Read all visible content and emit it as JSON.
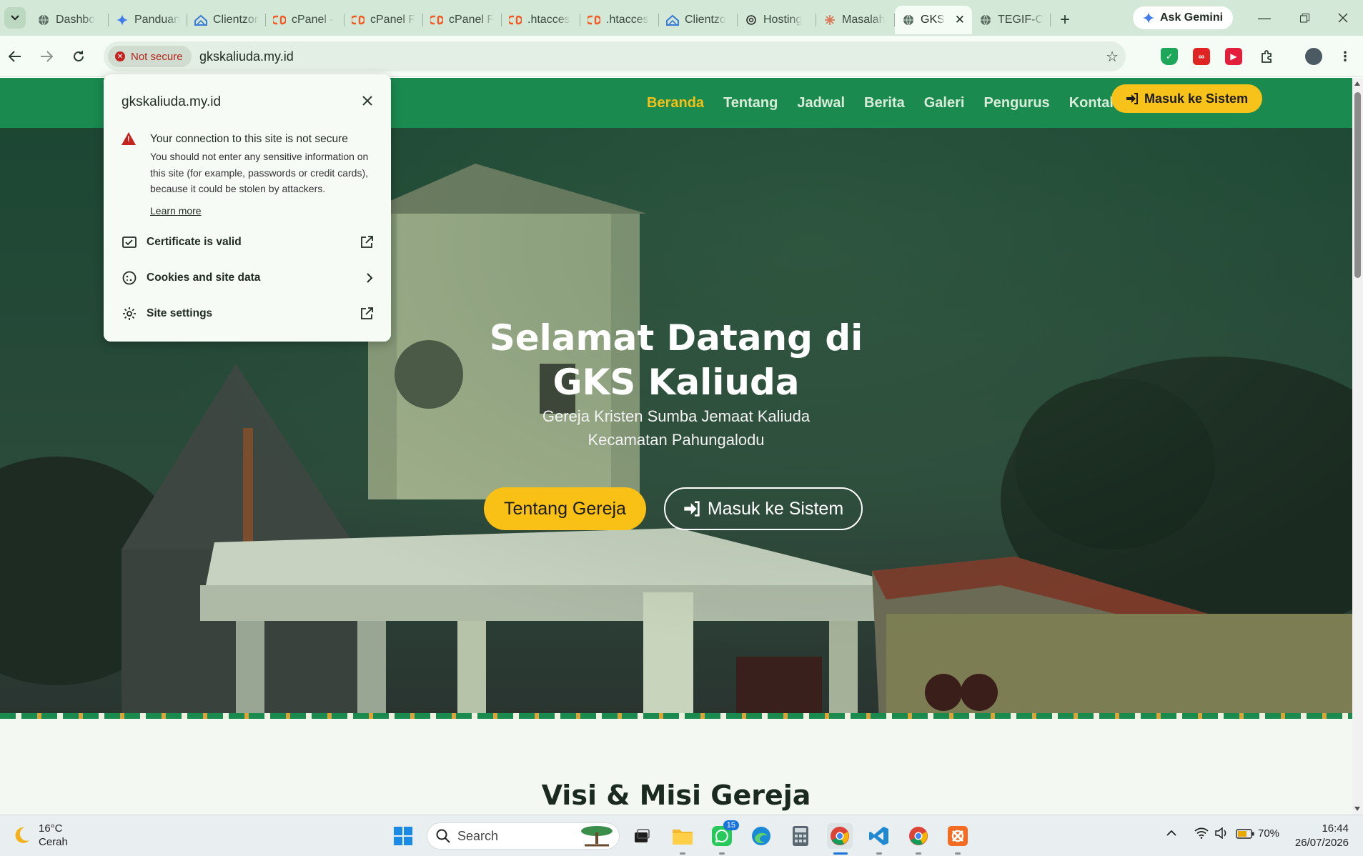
{
  "browser": {
    "tabs": [
      {
        "title": "Dashbo",
        "icon": "globe-icon"
      },
      {
        "title": "Panduan",
        "icon": "gemini-spark-icon"
      },
      {
        "title": "Clientzone",
        "icon": "clientzone-icon"
      },
      {
        "title": "cPanel -",
        "icon": "cpanel-icon"
      },
      {
        "title": "cPanel F",
        "icon": "cpanel-icon"
      },
      {
        "title": "cPanel F",
        "icon": "cpanel-icon"
      },
      {
        "title": ".htacces",
        "icon": "cpanel-icon"
      },
      {
        "title": ".htacces",
        "icon": "cpanel-icon"
      },
      {
        "title": "Clientzo",
        "icon": "clientzone-icon"
      },
      {
        "title": "Hosting",
        "icon": "openai-icon"
      },
      {
        "title": "Masalah",
        "icon": "claude-icon"
      },
      {
        "title": "GKS",
        "icon": "globe-icon",
        "active": true
      },
      {
        "title": "TEGIF-C",
        "icon": "globe-icon"
      }
    ],
    "gemini_label": "Ask Gemini",
    "security_chip": "Not secure",
    "url": "gkskaliuda.my.id"
  },
  "popup": {
    "host": "gkskaliuda.my.id",
    "warning_title": "Your connection to this site is not secure",
    "warning_body": "You should not enter any sensitive information on this site (for example, passwords or credit cards), because it could be stolen by attackers.",
    "learn_more": "Learn more",
    "rows": [
      {
        "label": "Certificate is valid",
        "icon": "certificate-icon",
        "action": "external-link-icon"
      },
      {
        "label": "Cookies and site data",
        "icon": "cookie-icon",
        "action": "chevron-right-icon"
      },
      {
        "label": "Site settings",
        "icon": "gear-icon",
        "action": "external-link-icon"
      }
    ]
  },
  "site": {
    "nav": [
      "Beranda",
      "Tentang",
      "Jadwal",
      "Berita",
      "Galeri",
      "Pengurus",
      "Kontak"
    ],
    "nav_active": "Beranda",
    "nav_cta": "Masuk ke Sistem",
    "hero_title_line1": "Selamat Datang di",
    "hero_title_line2": "GKS Kaliuda",
    "hero_sub_line1": "Gereja Kristen Sumba Jemaat Kaliuda",
    "hero_sub_line2": "Kecamatan Pahungalodu",
    "btn_primary": "Tentang Gereja",
    "btn_secondary": "Masuk ke Sistem",
    "section_title": "Visi & Misi Gereja",
    "colors": {
      "brand_green": "#1a8a4f",
      "accent_yellow": "#f9c015"
    }
  },
  "taskbar": {
    "temp": "16°C",
    "condition": "Cerah",
    "search_placeholder": "Search",
    "whatsapp_badge": "15",
    "battery": "70%",
    "time": "16:44",
    "date": "26/07/2026"
  }
}
